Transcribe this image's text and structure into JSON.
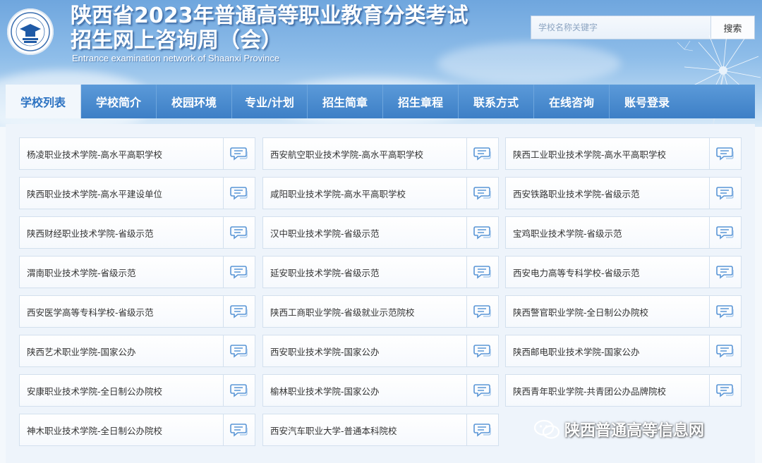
{
  "header": {
    "title_line1": "陕西省2023年普通高等职业教育分类考试",
    "title_line2": "招生网上咨询周（会）",
    "subtitle": "Entrance examination network of Shaanxi Province",
    "logo_icon": "graduation-cap-logo"
  },
  "search": {
    "placeholder": "学校名称关键字",
    "value": "",
    "button_label": "搜索"
  },
  "nav": {
    "items": [
      {
        "label": "学校列表",
        "active": true
      },
      {
        "label": "学校简介",
        "active": false
      },
      {
        "label": "校园环境",
        "active": false
      },
      {
        "label": "专业/计划",
        "active": false
      },
      {
        "label": "招生简章",
        "active": false
      },
      {
        "label": "招生章程",
        "active": false
      },
      {
        "label": "联系方式",
        "active": false
      },
      {
        "label": "在线咨询",
        "active": false
      },
      {
        "label": "账号登录",
        "active": false
      }
    ]
  },
  "schools": [
    [
      "杨凌职业技术学院-高水平高职学校",
      "西安航空职业技术学院-高水平高职学校",
      "陕西工业职业技术学院-高水平高职学校"
    ],
    [
      "陕西职业技术学院-高水平建设单位",
      "咸阳职业技术学院-高水平高职学校",
      "西安铁路职业技术学院-省级示范"
    ],
    [
      "陕西财经职业技术学院-省级示范",
      "汉中职业技术学院-省级示范",
      "宝鸡职业技术学院-省级示范"
    ],
    [
      "渭南职业技术学院-省级示范",
      "延安职业技术学院-省级示范",
      "西安电力高等专科学校-省级示范"
    ],
    [
      "西安医学高等专科学校-省级示范",
      "陕西工商职业学院-省级就业示范院校",
      "陕西警官职业学院-全日制公办院校"
    ],
    [
      "陕西艺术职业学院-国家公办",
      "西安职业技术学院-国家公办",
      "陕西邮电职业技术学院-国家公办"
    ],
    [
      "安康职业技术学院-全日制公办院校",
      "榆林职业技术学院-国家公办",
      "陕西青年职业学院-共青团公办品牌院校"
    ],
    [
      "神木职业技术学院-全日制公办院校",
      "西安汽车职业大学-普通本科院校",
      ""
    ]
  ],
  "chat_icon": "chat-bubble-icon",
  "watermark": {
    "text": "陕西普通高等信息网",
    "icon": "wechat-icon"
  },
  "colors": {
    "nav_bg": "#4a8bd0",
    "nav_active_text": "#2d73c2",
    "icon_blue": "#5a96d6"
  }
}
